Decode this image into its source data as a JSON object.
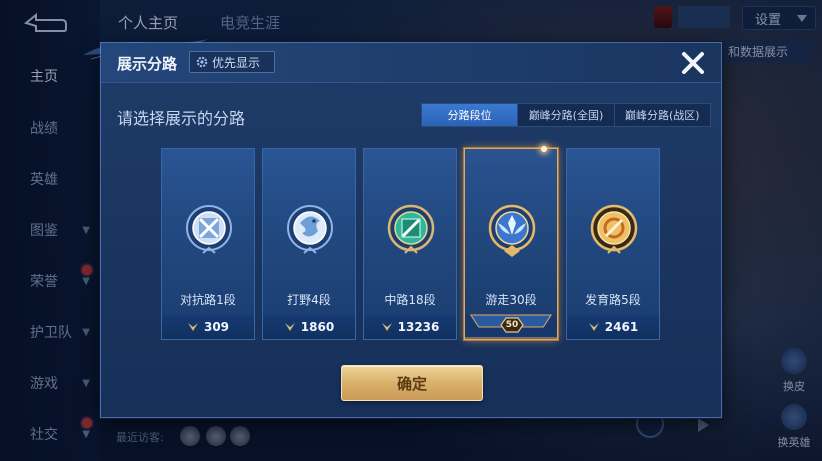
{
  "background": {
    "nav_items": [
      {
        "label": "主页",
        "active": true,
        "chevron": false
      },
      {
        "label": "战绩",
        "active": false,
        "chevron": false
      },
      {
        "label": "英雄",
        "active": false,
        "chevron": false
      },
      {
        "label": "图鉴",
        "active": false,
        "chevron": true
      },
      {
        "label": "荣誉",
        "active": false,
        "chevron": true,
        "reddot": true
      },
      {
        "label": "护卫队",
        "active": false,
        "chevron": true
      },
      {
        "label": "游戏",
        "active": false,
        "chevron": true
      },
      {
        "label": "社交",
        "active": false,
        "chevron": true,
        "reddot": true
      }
    ],
    "top_tabs": [
      "个人主页",
      "电竞生涯"
    ],
    "settings_label": "设置",
    "right_peek_label": "和数据展示",
    "side_tools": [
      "换皮",
      "换英雄"
    ],
    "recent_visitors_label": "最近访客:"
  },
  "modal": {
    "title": "展示分路",
    "priority_label": "优先显示",
    "subtitle": "请选择展示的分路",
    "segments": [
      {
        "label": "分路段位",
        "active": true
      },
      {
        "label": "巅峰分路(全国)",
        "active": false
      },
      {
        "label": "巅峰分路(战区)",
        "active": false
      }
    ],
    "cards": [
      {
        "rank": "对抗路1段",
        "score": "309",
        "emblem": "clash-lane-emblem-icon",
        "selected": false
      },
      {
        "rank": "打野4段",
        "score": "1860",
        "emblem": "jungle-emblem-icon",
        "selected": false
      },
      {
        "rank": "中路18段",
        "score": "13236",
        "emblem": "mid-lane-emblem-icon",
        "selected": false
      },
      {
        "rank": "游走30段",
        "score": "",
        "star_badge": "50",
        "emblem": "roam-emblem-icon",
        "selected": true
      },
      {
        "rank": "发育路5段",
        "score": "2461",
        "emblem": "farm-lane-emblem-icon",
        "selected": false
      }
    ],
    "confirm_label": "确定"
  },
  "colors": {
    "accent_blue": "#2b63b6",
    "gold": "#d9b06a",
    "selected_border": "#e0a860"
  }
}
